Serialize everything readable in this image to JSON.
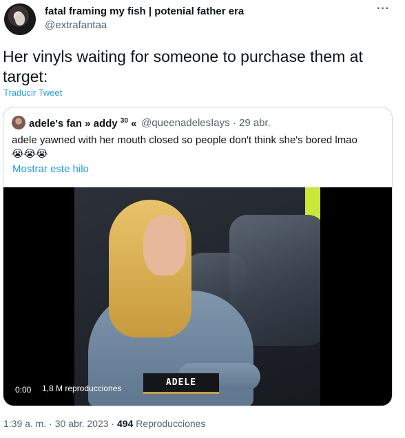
{
  "author": {
    "display_name": "fatal framing my fish | potenial father era",
    "handle": "@extrafantaa"
  },
  "more_icon": "more-icon",
  "tweet": {
    "text": "Her vinyls waiting for someone to purchase them at target:",
    "translate_label": "Traducir Tweet"
  },
  "quote": {
    "display_name": "adele's fan » addy",
    "display_name_sup": "30",
    "display_name_suffix": " «",
    "meta": "@queenadelesIays · 29 abr.",
    "text": "adele yawned with her mouth closed so people don't think she's bored lmao",
    "emoji": "😭😭😭",
    "show_thread": "Mostrar este hilo"
  },
  "video": {
    "time": "0:00",
    "views": "1,8 M reproducciones",
    "overlay_label": "ADELE"
  },
  "footer": {
    "timestamp": "1:39 a. m. · 30 abr. 2023 · ",
    "view_count": "494",
    "view_label": " Reproducciones"
  }
}
